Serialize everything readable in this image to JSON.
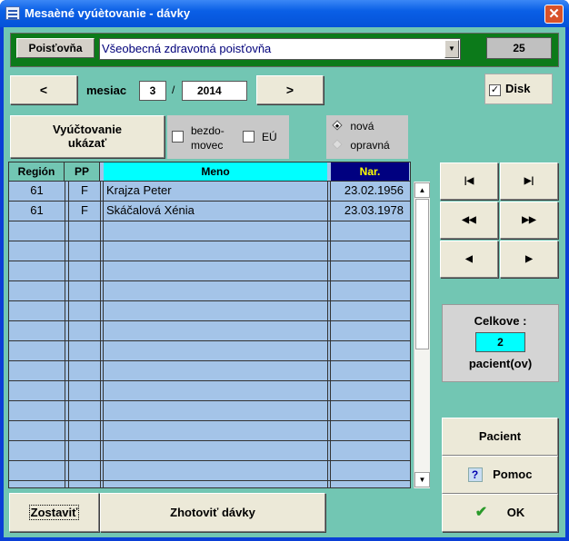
{
  "window": {
    "title": "Mesaèné vyúètovanie - dávky",
    "close": "✕"
  },
  "insurer": {
    "label": "Poisťovňa",
    "selected": "Všeobecná zdravotná poisťovňa",
    "code": "25"
  },
  "period": {
    "prev_label": "<",
    "next_label": ">",
    "month_label": "mesiac",
    "month": "3",
    "separator": "/",
    "year": "2014"
  },
  "disk": {
    "label": "Disk",
    "checked": true
  },
  "actions": {
    "show_billing": "Vyúčtovanie ukázať",
    "homeless_label": "bezdo-\nmovec",
    "eu_label": "EÚ"
  },
  "type_radio": {
    "option_new": "nová",
    "option_correction": "opravná",
    "selected": "nová"
  },
  "table": {
    "headers": {
      "region": "Región",
      "pp": "PP",
      "name": "Meno",
      "birth": "Nar."
    },
    "rows": [
      {
        "region": "61",
        "pp": "F",
        "name": "Krajza Peter",
        "birth": "23.02.1956"
      },
      {
        "region": "61",
        "pp": "F",
        "name": "Skáčalová Xénia",
        "birth": "23.03.1978"
      }
    ]
  },
  "navigation": {
    "first_icon": "first-record-icon",
    "last_icon": "last-record-icon",
    "rewind_icon": "rewind-icon",
    "fast_forward_icon": "fast-forward-icon",
    "prev_icon": "previous-record-icon",
    "next_icon": "next-record-icon"
  },
  "summary": {
    "label": "Celkove :",
    "count": "2",
    "unit": "pacient(ov)"
  },
  "buttons": {
    "patient": "Pacient",
    "help": "Pomoc",
    "ok": "OK",
    "compose": "Zostaviť",
    "create_batches": "Zhotoviť dávky"
  },
  "colors": {
    "background": "#72c6b3",
    "header_panel": "#0c7a1a",
    "grid": "#a4c4e8",
    "name_header": "#00ffff",
    "birth_header": "#000080",
    "birth_header_text": "#ffff00",
    "count_box": "#00ffff"
  }
}
